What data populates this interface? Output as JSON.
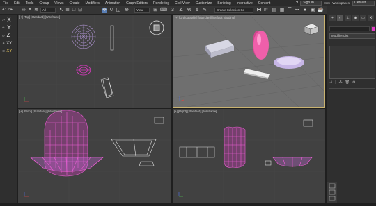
{
  "menubar": {
    "items": [
      "File",
      "Edit",
      "Tools",
      "Group",
      "Views",
      "Create",
      "Modifiers",
      "Animation",
      "Graph Editors",
      "Rendering",
      "Civil View",
      "Customize",
      "Scripting",
      "Interactive",
      "Content"
    ],
    "help_icon": "help-icon",
    "sign_in": "Sign In",
    "workspaces_label": "Workspaces:",
    "workspaces_value": "Default"
  },
  "toolbar": {
    "filter_value": "All",
    "view_value": "View",
    "selection_set_placeholder": "Create Selection Se"
  },
  "left_toolbar": {
    "items": [
      "X",
      "Y",
      "Z",
      "XY",
      "XY"
    ]
  },
  "viewports": {
    "top": "[+] [Top] [Standard] [Wireframe]",
    "perspective": "[+] [Orthographic] [Standard] [Default Shading]",
    "front": "[+] [Front] [Standard] [Wireframe]",
    "right": "[+] [Right] [Standard] [Wireframe]"
  },
  "command_panel": {
    "modifier_list": "Modifier List",
    "accent_color": "#e23ac7"
  },
  "colors": {
    "selection_magenta": "#e23ac7",
    "wire_white": "#e0e0e0",
    "active_border": "#c9b370"
  }
}
